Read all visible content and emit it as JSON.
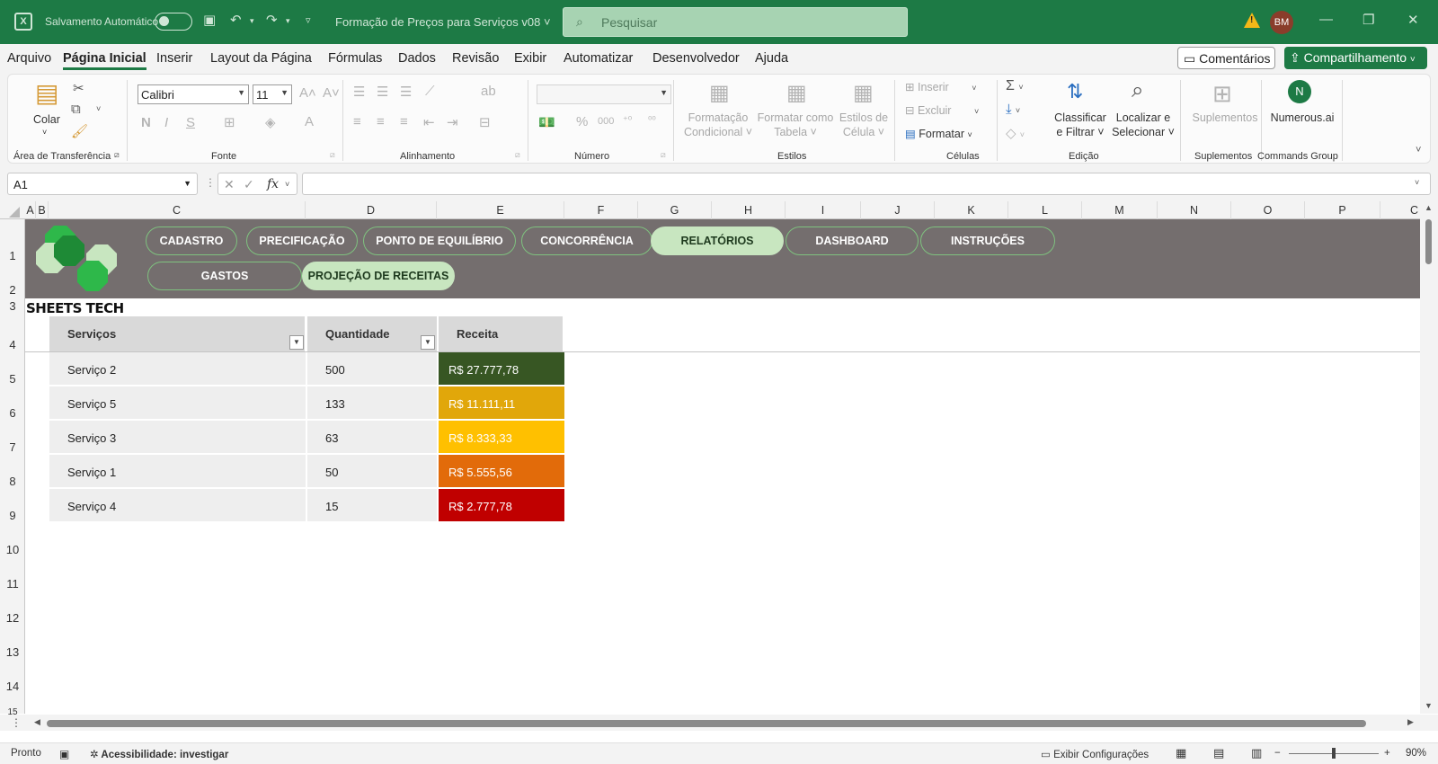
{
  "titlebar": {
    "autosave_label": "Salvamento Automático",
    "filename": "Formação de Preços para Serviços  v08",
    "search_placeholder": "Pesquisar",
    "avatar_initials": "BM"
  },
  "menu": {
    "items": [
      "Arquivo",
      "Página Inicial",
      "Inserir",
      "Layout da Página",
      "Fórmulas",
      "Dados",
      "Revisão",
      "Exibir",
      "Automatizar",
      "Desenvolvedor",
      "Ajuda"
    ],
    "active": "Página Inicial",
    "comments_label": "Comentários",
    "share_label": "Compartilhamento"
  },
  "ribbon": {
    "paste_label": "Colar",
    "font_name": "Calibri",
    "font_size": "11",
    "groups": {
      "clipboard": "Área de Transferência",
      "font": "Fonte",
      "alignment": "Alinhamento",
      "number": "Número",
      "styles": "Estilos",
      "cells": "Células",
      "editing": "Edição",
      "addins": "Suplementos",
      "commands": "Commands Group"
    },
    "styles": {
      "conditional_1": "Formatação",
      "conditional_2": "Condicional",
      "as_table_1": "Formatar como",
      "as_table_2": "Tabela",
      "cell_styles_1": "Estilos de",
      "cell_styles_2": "Célula"
    },
    "cells": {
      "insert": "Inserir",
      "delete": "Excluir",
      "format": "Formatar"
    },
    "editing": {
      "sort_1": "Classificar",
      "sort_2": "e Filtrar",
      "find_1": "Localizar e",
      "find_2": "Selecionar"
    },
    "addins_label": "Suplementos",
    "numerous_label": "Numerous.ai"
  },
  "formula_bar": {
    "name_box": "A1",
    "fx": "fx",
    "formula": ""
  },
  "columns": [
    "A",
    "B",
    "C",
    "D",
    "E",
    "F",
    "G",
    "H",
    "I",
    "J",
    "K",
    "L",
    "M",
    "N",
    "O",
    "P",
    "C"
  ],
  "rows": [
    "1",
    "2",
    "3",
    "4",
    "5",
    "6",
    "7",
    "8",
    "9",
    "10",
    "11",
    "12",
    "13",
    "14",
    "15"
  ],
  "nav": {
    "row1": [
      "CADASTRO",
      "PRECIFICAÇÃO",
      "PONTO DE EQUILÍBRIO",
      "CONCORRÊNCIA",
      "RELATÓRIOS",
      "DASHBOARD",
      "INSTRUÇÕES"
    ],
    "row2": [
      "GASTOS",
      "PROJEÇÃO DE RECEITAS"
    ],
    "active_row1": "RELATÓRIOS",
    "active_row2": "PROJEÇÃO DE RECEITAS"
  },
  "brand": "SHEETS TECH",
  "table": {
    "headers": [
      "Serviços",
      "Quantidade",
      "Receita"
    ],
    "rows": [
      {
        "service": "Serviço 2",
        "qty": "500",
        "revenue": "R$ 27.777,78",
        "color": "#375623"
      },
      {
        "service": "Serviço 5",
        "qty": "133",
        "revenue": "R$ 11.111,11",
        "color": "#e1a70a"
      },
      {
        "service": "Serviço 3",
        "qty": "63",
        "revenue": "R$ 8.333,33",
        "color": "#ffc000"
      },
      {
        "service": "Serviço 1",
        "qty": "50",
        "revenue": "R$ 5.555,56",
        "color": "#e26b0a"
      },
      {
        "service": "Serviço 4",
        "qty": "15",
        "revenue": "R$ 2.777,78",
        "color": "#c00000"
      }
    ]
  },
  "status": {
    "ready": "Pronto",
    "accessibility": "Acessibilidade: investigar",
    "display_settings": "Exibir Configurações",
    "zoom": "90%"
  }
}
